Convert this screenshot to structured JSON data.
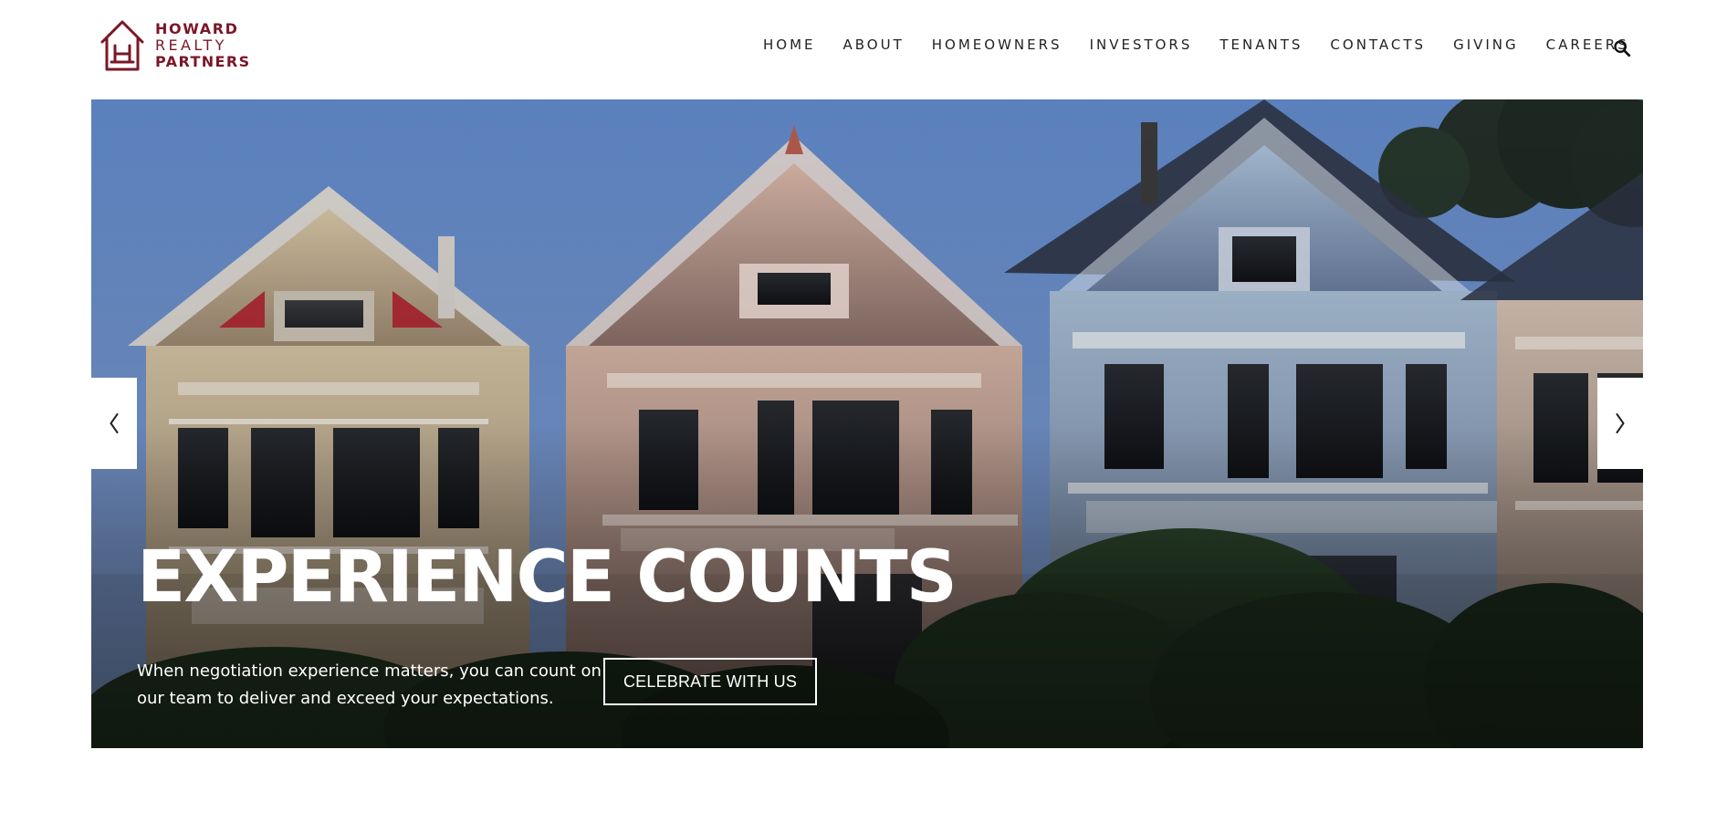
{
  "brand": {
    "name_line1": "HOWARD",
    "name_line2": "REALTY",
    "name_line3": "PARTNERS",
    "color": "#7a1727"
  },
  "nav": {
    "items": [
      {
        "label": "HOME"
      },
      {
        "label": "ABOUT"
      },
      {
        "label": "HOMEOWNERS"
      },
      {
        "label": "INVESTORS"
      },
      {
        "label": "TENANTS"
      },
      {
        "label": "CONTACTS"
      },
      {
        "label": "GIVING"
      },
      {
        "label": "CAREERS"
      }
    ],
    "search_icon": "search-icon"
  },
  "hero": {
    "title": "EXPERIENCE COUNTS",
    "text": "When negotiation experience matters, you can count on our team to deliver and exceed your expectations.",
    "button_label": "CELEBRATE WITH US",
    "prev_icon": "chevron-left-icon",
    "next_icon": "chevron-right-icon"
  }
}
